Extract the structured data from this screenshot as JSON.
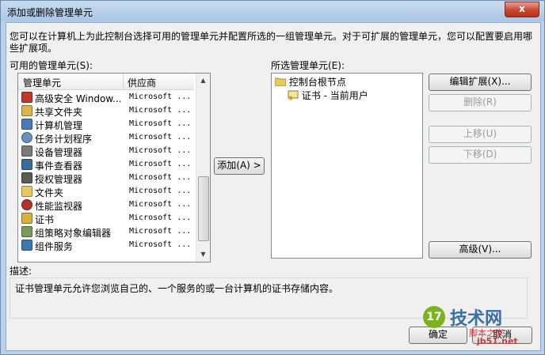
{
  "window": {
    "title": "添加或删除管理单元",
    "close_glyph": "x"
  },
  "intro": "您可以在计算机上为此控制台选择可用的管理单元并配置所选的一组管理单元。对于可扩展的管理单元，您可以配置要启用哪些扩展项。",
  "available": {
    "label": "可用的管理单元(S):",
    "col_name": "管理单元",
    "col_vendor": "供应商",
    "rows": [
      {
        "name": "高级安全 Window...",
        "vendor": "Microsoft ...",
        "icon": "firewall-icon"
      },
      {
        "name": "共享文件夹",
        "vendor": "Microsoft ...",
        "icon": "shared-folder-icon"
      },
      {
        "name": "计算机管理",
        "vendor": "Microsoft ...",
        "icon": "computer-management-icon"
      },
      {
        "name": "任务计划程序",
        "vendor": "Microsoft ...",
        "icon": "clock-icon"
      },
      {
        "name": "设备管理器",
        "vendor": "Microsoft ...",
        "icon": "device-manager-icon"
      },
      {
        "name": "事件查看器",
        "vendor": "Microsoft ...",
        "icon": "event-viewer-icon"
      },
      {
        "name": "授权管理器",
        "vendor": "Microsoft ...",
        "icon": "authorization-icon"
      },
      {
        "name": "文件夹",
        "vendor": "Microsoft ...",
        "icon": "folder-icon"
      },
      {
        "name": "性能监视器",
        "vendor": "Microsoft ...",
        "icon": "performance-icon"
      },
      {
        "name": "证书",
        "vendor": "Microsoft ...",
        "icon": "certificate-icon"
      },
      {
        "name": "组策略对象编辑器",
        "vendor": "Microsoft ...",
        "icon": "group-policy-icon"
      },
      {
        "name": "组件服务",
        "vendor": "Microsoft ...",
        "icon": "component-services-icon"
      }
    ]
  },
  "add_button": "添加(A) >",
  "selected": {
    "label": "所选管理单元(E):",
    "root": "控制台根节点",
    "child": "证书 - 当前用户"
  },
  "buttons": {
    "edit_extensions": "编辑扩展(X)...",
    "remove": "删除(R)",
    "move_up": "上移(U)",
    "move_down": "下移(D)",
    "advanced": "高级(V)...",
    "ok": "确定",
    "cancel": "取消"
  },
  "description": {
    "label": "描述:",
    "text": "证书管理单元允许您浏览自己的、一个服务的或一台计算机的证书存储内容。"
  },
  "watermark": {
    "line1": "技术网",
    "line2": "脚本之家",
    "line3": "jb51.net",
    "badge": "17"
  }
}
